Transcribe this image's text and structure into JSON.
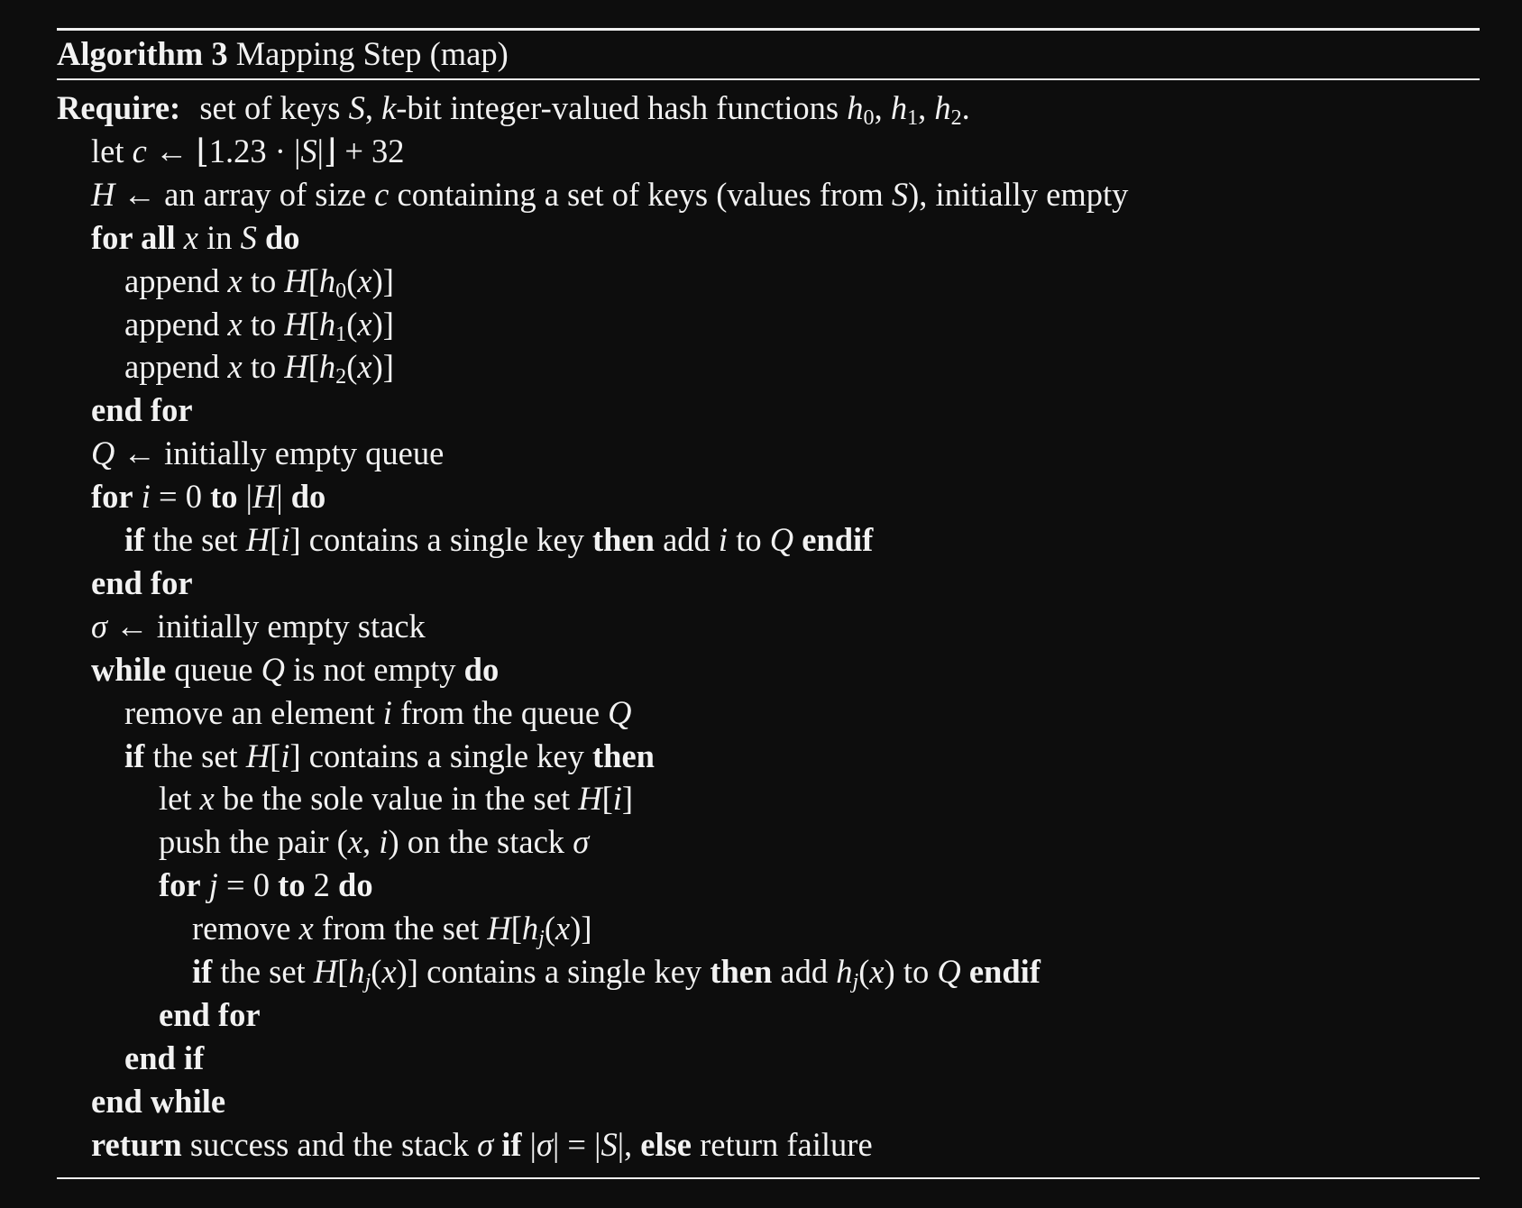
{
  "caption": {
    "label": "Algorithm 3",
    "title": "Mapping Step (map)"
  },
  "require": {
    "keyword": "Require:",
    "text": "set of keys S, k-bit integer-valued hash functions h0, h1, h2."
  },
  "lines": [
    {
      "id": "let-c",
      "text": "let c ← ⌊1.23 · |S|⌋ + 32"
    },
    {
      "id": "init-h",
      "text": "H ← an array of size c containing a set of keys (values from S), initially empty"
    },
    {
      "id": "for-all",
      "text": "for all x in S do"
    },
    {
      "id": "append-0",
      "text": "append x to H[h0(x)]"
    },
    {
      "id": "append-1",
      "text": "append x to H[h1(x)]"
    },
    {
      "id": "append-2",
      "text": "append x to H[h2(x)]"
    },
    {
      "id": "end-for-1",
      "text": "end for"
    },
    {
      "id": "init-q",
      "text": "Q ← initially empty queue"
    },
    {
      "id": "for-i",
      "text": "for i = 0 to |H| do"
    },
    {
      "id": "if-single",
      "text": "if the set H[i] contains a single key then add i to Q endif"
    },
    {
      "id": "end-for-2",
      "text": "end for"
    },
    {
      "id": "init-sigma",
      "text": "σ ← initially empty stack"
    },
    {
      "id": "while",
      "text": "while queue Q is not empty do"
    },
    {
      "id": "remove-i",
      "text": "remove an element i from the queue Q"
    },
    {
      "id": "if-single-2",
      "text": "if the set H[i] contains a single key then"
    },
    {
      "id": "let-x",
      "text": "let x be the sole value in the set H[i]"
    },
    {
      "id": "push",
      "text": "push the pair (x, i) on the stack σ"
    },
    {
      "id": "for-j",
      "text": "for j = 0 to 2 do"
    },
    {
      "id": "remove-x",
      "text": "remove x from the set H[hj(x)]"
    },
    {
      "id": "if-single-3",
      "text": "if the set H[hj(x)] contains a single key then add hj(x) to Q endif"
    },
    {
      "id": "end-for-3",
      "text": "end for"
    },
    {
      "id": "end-if",
      "text": "end if"
    },
    {
      "id": "end-while",
      "text": "end while"
    },
    {
      "id": "return",
      "text": "return success and the stack σ if |σ| = |S|, else return failure"
    }
  ]
}
